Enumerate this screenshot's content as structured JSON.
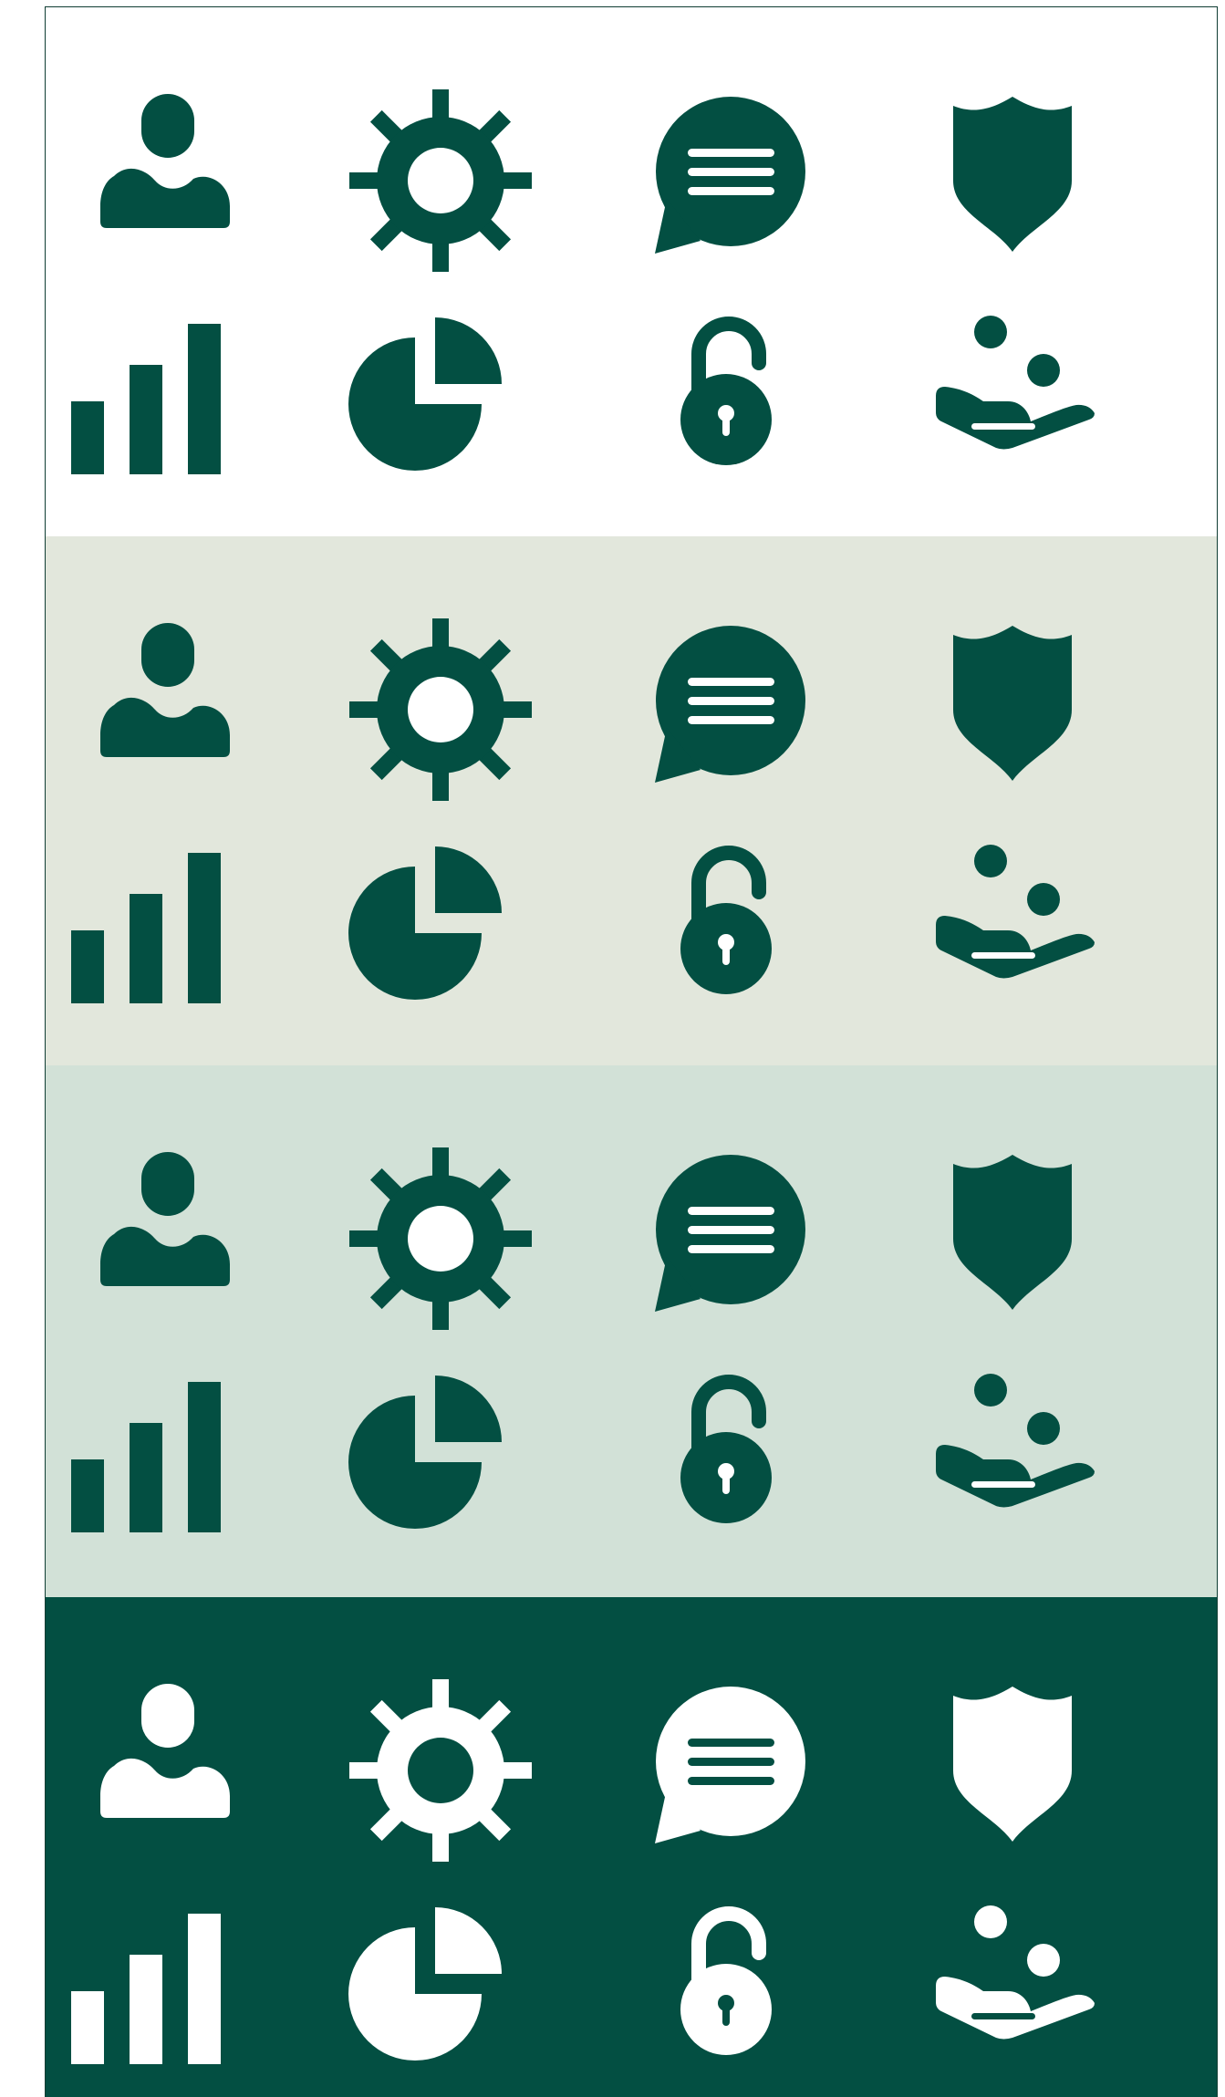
{
  "colors": {
    "brand_green": "#034f42",
    "white": "#ffffff",
    "light_sage": "#e2e7dc",
    "pale_green": "#d2e1d7",
    "border": "#0f3d33"
  },
  "icon_order": [
    "user-icon",
    "gear-icon",
    "chat-bubble-icon",
    "shield-icon",
    "bar-chart-icon",
    "pie-chart-icon",
    "unlocked-padlock-icon",
    "hand-receiving-coins-icon"
  ],
  "panels": [
    {
      "name": "white-background-panel",
      "background": "#ffffff",
      "icon_color": "#034f42",
      "cutout_color": "#ffffff"
    },
    {
      "name": "light-sage-background-panel",
      "background": "#e2e7dc",
      "icon_color": "#034f42",
      "cutout_color": "#ffffff"
    },
    {
      "name": "pale-green-background-panel",
      "background": "#d2e1d7",
      "icon_color": "#034f42",
      "cutout_color": "#ffffff"
    },
    {
      "name": "dark-green-background-panel",
      "background": "#034f42",
      "icon_color": "#ffffff",
      "cutout_color": "#034f42"
    }
  ]
}
